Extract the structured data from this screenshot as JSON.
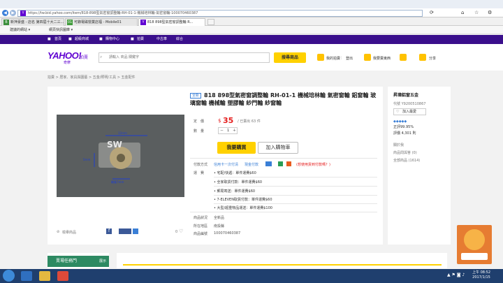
{
  "browser": {
    "url": "https://tw.bid.yahoo.com/item/818-898型氣密窗調整輪-RH-01-1-機械培林輪-氣密窗輪-100070460387",
    "url_prefix": "https://tw.bid.yahoo.com/item/818-898型氣密窗調整輪-RH-01-1-機械培林輪-氣密窗輪-100070460387",
    "tabs": [
      {
        "label": "新萍豪盛 - 店名 第四屆十大二三...",
        "icon": "B"
      },
      {
        "label": "可錄電磁營業店福 - Mobile01",
        "icon": "01"
      },
      {
        "label": "818 898型氣密窗調整輪 R...",
        "icon": "Y"
      }
    ],
    "favorites": [
      "建議的網站 ▾",
      "網頁快訊圖庫 ▾"
    ]
  },
  "topnav": {
    "items": [
      "首頁",
      "超級商城",
      "購物中心",
      "拍賣",
      "中古車",
      "綜合"
    ]
  },
  "header": {
    "logo": "YAHOO!",
    "logo_sub": "奇摩",
    "logo_auction": "拍賣",
    "search_placeholder": "請輸入 商品 關鍵字",
    "search_button": "搜尋商品",
    "links": [
      "我的拍賣",
      "登出",
      "我要賣東西",
      "",
      "分享"
    ]
  },
  "breadcrumb": "拍賣  >  居家、家具與園藝  >  五金/照明/工具  >  五金配件",
  "product": {
    "tag": "全新",
    "title": "818 898型氣密窗調整輪 RH-01-1 機械培林輪 氣密窗輪 鋁窗輪 玻璃窗輪 機械輪 塑膠輪 紗門輪 紗窗輪",
    "price_label": "定　價",
    "price_currency": "$",
    "price": "35",
    "sold": "/ 已賣出 63 件",
    "qty_label": "數　量",
    "qty_value": "1",
    "qty_minus": "－",
    "qty_plus": "＋",
    "buy_button": "我要購買",
    "cart_button": "加入購物車",
    "pay_label": "付款方式",
    "pay_methods": [
      "信用卡一次付清",
      "現金付款",
      "",
      "",
      "(想使用貨到付款嗎？)"
    ],
    "ship_label": "運　費",
    "shipping": [
      "宅配/快遞：單件運費$60",
      "全家取貨付款：單件運費$60",
      "郵局寄送：單件運費$60",
      "7-ELEVEN取貨付款：單件運費$60",
      "大型/超重物品運送：單件運費$100"
    ],
    "status_label": "商品狀況",
    "status": "全新品",
    "location_label": "所在地區",
    "location": "南投縣",
    "id_label": "商品編號",
    "item_id": "100070460387",
    "report": "檢舉商品",
    "share_count": "0",
    "photo_text": "SW",
    "photo_labels": [
      "12mm",
      "5mm",
      "輪寬7mm"
    ]
  },
  "seller": {
    "name": "昇瑋鋁窗五金",
    "id": "代號 Y9200510867",
    "follow": "加入最愛",
    "rating_pct": "正評99.95%",
    "rating_count": "評價 4,301 則",
    "links": [
      "關於我",
      "商品問與答 (0)",
      "全部商品 (1614)"
    ]
  },
  "bottom": {
    "sidebar_head": "賣場任務門",
    "sidebar_more": "展示"
  },
  "promo": {
    "text": "好\n康"
  },
  "taskbar": {
    "time": "上午 08:52",
    "date": "2017/1/15"
  },
  "colors": {
    "yahoo_purple": "#5f01d1",
    "nav_purple": "#3a0f8c",
    "buy_yellow": "#ffd100",
    "price_red": "#e51e1e"
  }
}
